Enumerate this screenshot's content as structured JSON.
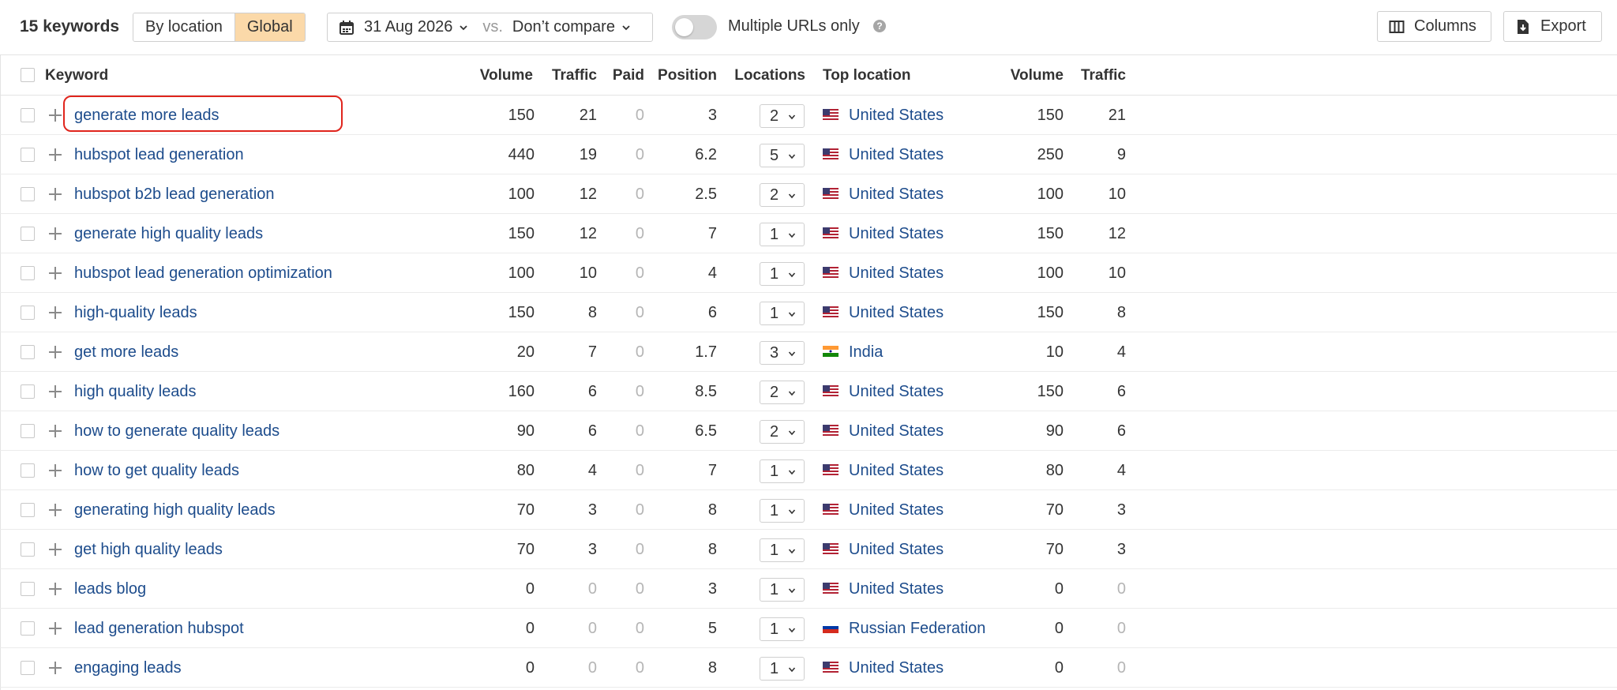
{
  "toolbar": {
    "keyword_count": "15 keywords",
    "segments": [
      {
        "label": "By location",
        "active": false
      },
      {
        "label": "Global",
        "active": true
      }
    ],
    "date": "31 Aug 2026",
    "vs_label": "vs.",
    "compare": "Don’t compare",
    "toggle_label": "Multiple URLs only",
    "help_glyph": "?",
    "columns_label": "Columns",
    "export_label": "Export"
  },
  "table": {
    "headers": {
      "keyword": "Keyword",
      "volume": "Volume",
      "traffic": "Traffic",
      "paid": "Paid",
      "position": "Position",
      "locations": "Locations",
      "top_location": "Top location",
      "top_volume": "Volume",
      "top_traffic": "Traffic"
    },
    "rows": [
      {
        "keyword": "generate more leads",
        "volume": "150",
        "traffic": "21",
        "paid": "0",
        "position": "3",
        "locations": "2",
        "flag": "us",
        "country": "United States",
        "top_volume": "150",
        "top_traffic": "21"
      },
      {
        "keyword": "hubspot lead generation",
        "volume": "440",
        "traffic": "19",
        "paid": "0",
        "position": "6.2",
        "locations": "5",
        "flag": "us",
        "country": "United States",
        "top_volume": "250",
        "top_traffic": "9"
      },
      {
        "keyword": "hubspot b2b lead generation",
        "volume": "100",
        "traffic": "12",
        "paid": "0",
        "position": "2.5",
        "locations": "2",
        "flag": "us",
        "country": "United States",
        "top_volume": "100",
        "top_traffic": "10"
      },
      {
        "keyword": "generate high quality leads",
        "volume": "150",
        "traffic": "12",
        "paid": "0",
        "position": "7",
        "locations": "1",
        "flag": "us",
        "country": "United States",
        "top_volume": "150",
        "top_traffic": "12"
      },
      {
        "keyword": "hubspot lead generation optimization",
        "volume": "100",
        "traffic": "10",
        "paid": "0",
        "position": "4",
        "locations": "1",
        "flag": "us",
        "country": "United States",
        "top_volume": "100",
        "top_traffic": "10"
      },
      {
        "keyword": "high-quality leads",
        "volume": "150",
        "traffic": "8",
        "paid": "0",
        "position": "6",
        "locations": "1",
        "flag": "us",
        "country": "United States",
        "top_volume": "150",
        "top_traffic": "8"
      },
      {
        "keyword": "get more leads",
        "volume": "20",
        "traffic": "7",
        "paid": "0",
        "position": "1.7",
        "locations": "3",
        "flag": "in",
        "country": "India",
        "top_volume": "10",
        "top_traffic": "4"
      },
      {
        "keyword": "high quality leads",
        "volume": "160",
        "traffic": "6",
        "paid": "0",
        "position": "8.5",
        "locations": "2",
        "flag": "us",
        "country": "United States",
        "top_volume": "150",
        "top_traffic": "6"
      },
      {
        "keyword": "how to generate quality leads",
        "volume": "90",
        "traffic": "6",
        "paid": "0",
        "position": "6.5",
        "locations": "2",
        "flag": "us",
        "country": "United States",
        "top_volume": "90",
        "top_traffic": "6"
      },
      {
        "keyword": "how to get quality leads",
        "volume": "80",
        "traffic": "4",
        "paid": "0",
        "position": "7",
        "locations": "1",
        "flag": "us",
        "country": "United States",
        "top_volume": "80",
        "top_traffic": "4"
      },
      {
        "keyword": "generating high quality leads",
        "volume": "70",
        "traffic": "3",
        "paid": "0",
        "position": "8",
        "locations": "1",
        "flag": "us",
        "country": "United States",
        "top_volume": "70",
        "top_traffic": "3"
      },
      {
        "keyword": "get high quality leads",
        "volume": "70",
        "traffic": "3",
        "paid": "0",
        "position": "8",
        "locations": "1",
        "flag": "us",
        "country": "United States",
        "top_volume": "70",
        "top_traffic": "3"
      },
      {
        "keyword": "leads blog",
        "volume": "0",
        "traffic": "0",
        "paid": "0",
        "position": "3",
        "locations": "1",
        "flag": "us",
        "country": "United States",
        "top_volume": "0",
        "top_traffic": "0"
      },
      {
        "keyword": "lead generation hubspot",
        "volume": "0",
        "traffic": "0",
        "paid": "0",
        "position": "5",
        "locations": "1",
        "flag": "ru",
        "country": "Russian Federation",
        "top_volume": "0",
        "top_traffic": "0"
      },
      {
        "keyword": "engaging leads",
        "volume": "0",
        "traffic": "0",
        "paid": "0",
        "position": "8",
        "locations": "1",
        "flag": "us",
        "country": "United States",
        "top_volume": "0",
        "top_traffic": "0"
      }
    ]
  },
  "colors": {
    "link": "#1d4c8c",
    "active_segment": "#fbd9a9",
    "highlight": "#e0251d",
    "muted": "#b5b5b5"
  }
}
